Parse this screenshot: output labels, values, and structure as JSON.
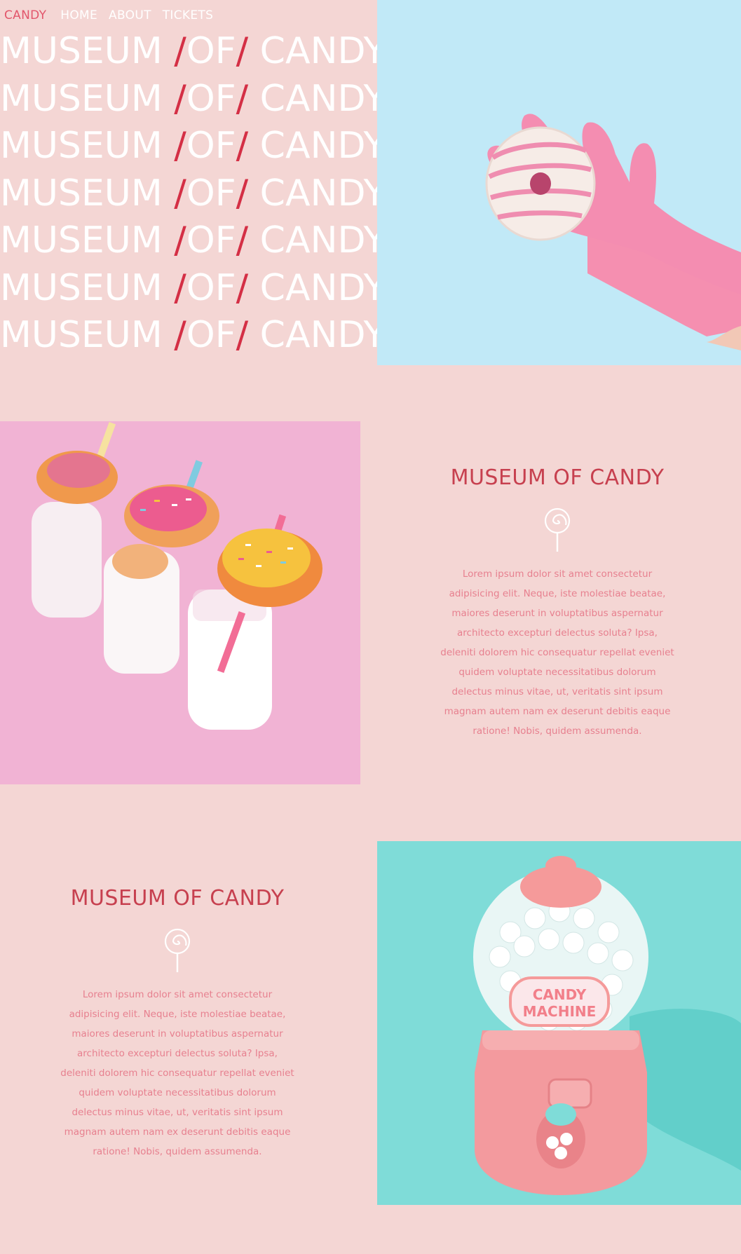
{
  "nav": {
    "brand": "CANDY",
    "links": [
      "HOME",
      "ABOUT",
      "TICKETS"
    ]
  },
  "hero": {
    "lines": [
      {
        "a": "MUSEUM ",
        "s1": "/",
        "b": "OF",
        "s2": "/",
        "c": " CANDY"
      },
      {
        "a": "MUSEUM ",
        "s1": "/",
        "b": "OF",
        "s2": "/",
        "c": " CANDY"
      },
      {
        "a": "MUSEUM ",
        "s1": "/",
        "b": "OF",
        "s2": "/",
        "c": " CANDY"
      },
      {
        "a": "MUSEUM ",
        "s1": "/",
        "b": "OF",
        "s2": "/",
        "c": " CANDY"
      },
      {
        "a": "MUSEUM ",
        "s1": "/",
        "b": "OF",
        "s2": "/",
        "c": " CANDY"
      },
      {
        "a": "MUSEUM ",
        "s1": "/",
        "b": "OF",
        "s2": "/",
        "c": " CANDY"
      },
      {
        "a": "MUSEUM ",
        "s1": "/",
        "b": "OF",
        "s2": "/",
        "c": " CANDY"
      }
    ]
  },
  "section1": {
    "title": "MUSEUM OF CANDY",
    "icon": "lollipop-icon",
    "body": "Lorem ipsum dolor sit amet consectetur adipisicing elit. Neque, iste molestiae beatae, maiores deserunt in voluptatibus aspernatur architecto excepturi delectus soluta? Ipsa, deleniti dolorem hic consequatur repellat eveniet quidem voluptate necessitatibus dolorum delectus minus vitae, ut, veritatis sint ipsum magnam autem nam ex deserunt debitis eaque ratione! Nobis, quidem assumenda."
  },
  "section2": {
    "title": "MUSEUM OF CANDY",
    "icon": "lollipop-icon",
    "body": "Lorem ipsum dolor sit amet consectetur adipisicing elit. Neque, iste molestiae beatae, maiores deserunt in voluptatibus aspernatur architecto excepturi delectus soluta? Ipsa, deleniti dolorem hic consequatur repellat eveniet quidem voluptate necessitatibus dolorum delectus minus vitae, ut, veritatis sint ipsum magnam autem nam ex deserunt debitis eaque ratione! Nobis, quidem assumenda."
  },
  "images": {
    "glove_donut": {
      "icon": "donut-in-glove-image"
    },
    "milk_donuts": {
      "icon": "milk-bottles-with-donuts-image"
    },
    "gumball": {
      "icon": "candy-machine-image",
      "label_line1": "CANDY",
      "label_line2": "MACHINE"
    }
  },
  "colors": {
    "background": "#f4d6d4",
    "accent": "#d42f45",
    "title": "#c7404f",
    "body_text": "#e7808f",
    "sky": "#c1e9f7",
    "teal": "#7fdcd8"
  }
}
